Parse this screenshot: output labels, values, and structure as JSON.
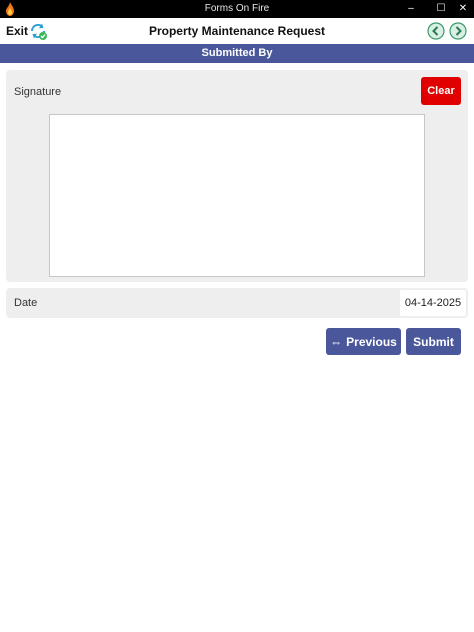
{
  "window": {
    "title": "Forms On Fire",
    "minimize": "–",
    "maximize": "☐",
    "close": "✕"
  },
  "appbar": {
    "exit_label": "Exit",
    "form_title": "Property Maintenance Request"
  },
  "section": {
    "title": "Submitted By"
  },
  "signature": {
    "label": "Signature",
    "clear_label": "Clear"
  },
  "date": {
    "label": "Date",
    "value": "04-14-2025"
  },
  "actions": {
    "previous_arrow": "⇔",
    "previous_label": "Previous",
    "submit_label": "Submit"
  },
  "colors": {
    "accent": "#4a589b",
    "danger": "#e00000",
    "panel": "#eeeeee",
    "nav_green": "#3a9a6a"
  }
}
